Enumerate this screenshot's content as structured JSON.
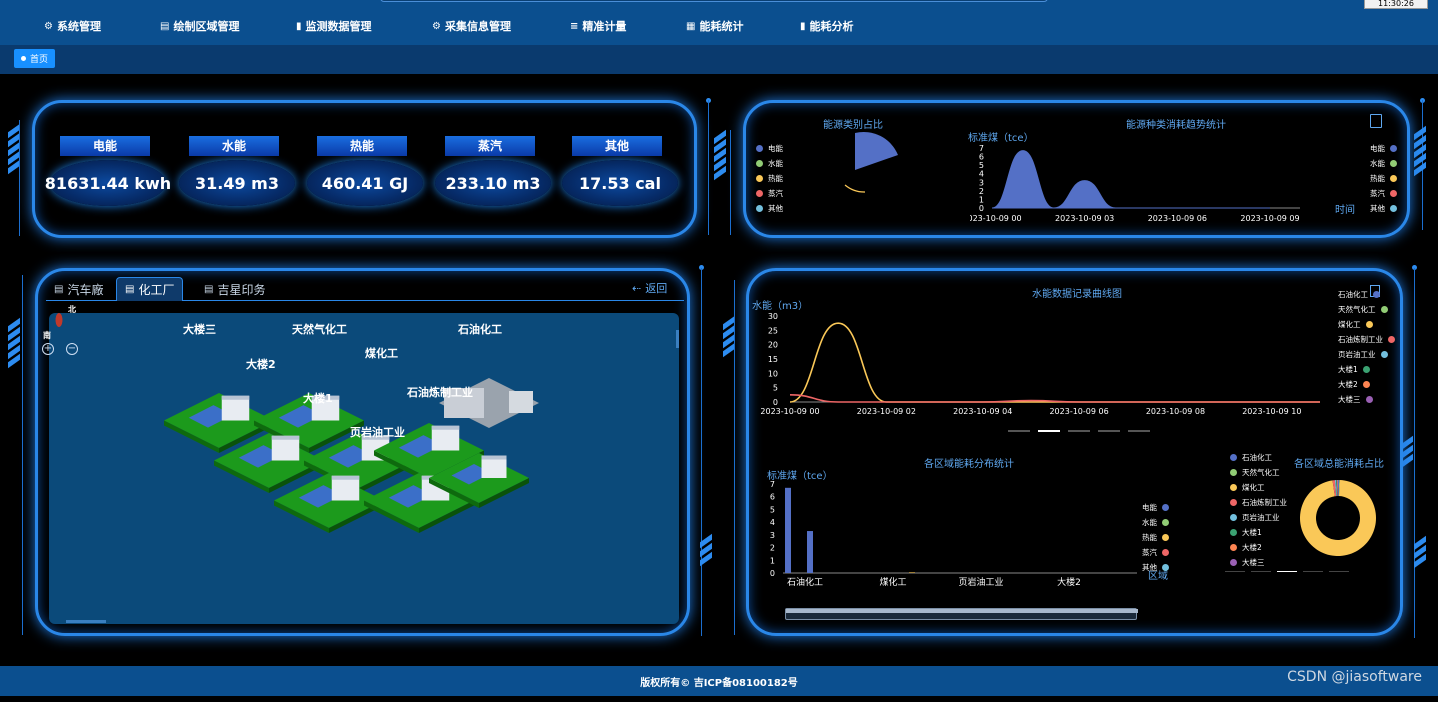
{
  "clock": "11:30:26",
  "nav": [
    {
      "label": "系统管理",
      "icon": "gear-icon",
      "glyph": "⚙"
    },
    {
      "label": "绘制区域管理",
      "icon": "draw-icon",
      "glyph": "▤"
    },
    {
      "label": "监测数据管理",
      "icon": "bar-chart-icon",
      "glyph": "▮"
    },
    {
      "label": "采集信息管理",
      "icon": "gear-icon",
      "glyph": "⚙"
    },
    {
      "label": "精准计量",
      "icon": "sliders-icon",
      "glyph": "≡"
    },
    {
      "label": "能耗统计",
      "icon": "calculator-icon",
      "glyph": "▦"
    },
    {
      "label": "能耗分析",
      "icon": "bar-chart-icon",
      "glyph": "▮"
    }
  ],
  "home_tab": "首页",
  "metrics": [
    {
      "label": "电能",
      "value": "81631.44 kwh"
    },
    {
      "label": "水能",
      "value": "31.49 m3"
    },
    {
      "label": "热能",
      "value": "460.41 GJ"
    },
    {
      "label": "蒸汽",
      "value": "233.10 m3"
    },
    {
      "label": "其他",
      "value": "17.53 cal"
    }
  ],
  "energy_legend": [
    "电能",
    "水能",
    "热能",
    "蒸汽",
    "其他"
  ],
  "energy_colors": [
    "#5470c6",
    "#91cc75",
    "#fac858",
    "#ee6666",
    "#73c0de"
  ],
  "pie_chart": {
    "title": "能源类别占比"
  },
  "trend_chart": {
    "title": "能源种类消耗趋势统计",
    "ylabel": "标准煤（tce）",
    "xlabel": "时间",
    "yticks": [
      "7",
      "6",
      "5",
      "4",
      "3",
      "2",
      "1",
      "0"
    ],
    "xticks": [
      "2023-10-09 00",
      "2023-10-09 03",
      "2023-10-09 06",
      "2023-10-09 09"
    ]
  },
  "tabs": [
    {
      "label": "汽车廠",
      "active": false
    },
    {
      "label": "化工厂",
      "active": true
    },
    {
      "label": "吉星印务",
      "active": false
    }
  ],
  "back_label": "返回",
  "compass": {
    "north": "北",
    "south": "南"
  },
  "map_labels": [
    "大楼三",
    "天然气化工",
    "石油化工",
    "煤化工",
    "大楼2",
    "石油炼制工业",
    "大楼1",
    "页岩油工业"
  ],
  "water_chart": {
    "title": "水能数据记录曲线图",
    "ylabel": "水能（m3）",
    "yticks": [
      "30",
      "25",
      "20",
      "15",
      "10",
      "5",
      "0"
    ],
    "xticks": [
      "2023-10-09 00",
      "2023-10-09 02",
      "2023-10-09 04",
      "2023-10-09 06",
      "2023-10-09 08",
      "2023-10-09 10"
    ],
    "legend": [
      "石油化工",
      "天然气化工",
      "煤化工",
      "石油炼制工业",
      "页岩油工业",
      "大楼1",
      "大楼2",
      "大楼三"
    ]
  },
  "area_chart": {
    "title": "各区域能耗分布统计",
    "ylabel": "标准煤（tce）",
    "xlabel": "区域",
    "yticks": [
      "7",
      "6",
      "5",
      "4",
      "3",
      "2",
      "1",
      "0"
    ],
    "xticks": [
      "石油化工",
      "煤化工",
      "页岩油工业",
      "大楼2"
    ]
  },
  "donut_chart": {
    "title": "各区域总能消耗占比",
    "legend": [
      "石油化工",
      "天然气化工",
      "煤化工",
      "石油炼制工业",
      "页岩油工业",
      "大楼1",
      "大楼2",
      "大楼三"
    ]
  },
  "region_colors": [
    "#5470c6",
    "#91cc75",
    "#fac858",
    "#ee6666",
    "#73c0de",
    "#3ba272",
    "#fc8452",
    "#9a60b4"
  ],
  "footer": "版权所有© 吉ICP备08100182号",
  "watermark": "CSDN @jiasoftware",
  "chart_data": [
    {
      "type": "area",
      "title": "能源种类消耗趋势统计",
      "xlabel": "时间",
      "ylabel": "标准煤（tce）",
      "ylim": [
        0,
        7
      ],
      "x": [
        "2023-10-09 00",
        "2023-10-09 01",
        "2023-10-09 02",
        "2023-10-09 03",
        "2023-10-09 04",
        "2023-10-09 05",
        "2023-10-09 06",
        "2023-10-09 07",
        "2023-10-09 08",
        "2023-10-09 09"
      ],
      "series": [
        {
          "name": "电能",
          "values": [
            0,
            6.7,
            0,
            3.2,
            0,
            0,
            0,
            0,
            0,
            0
          ]
        },
        {
          "name": "水能",
          "values": [
            0,
            0,
            0,
            0,
            0,
            0,
            0,
            0,
            0,
            0
          ]
        },
        {
          "name": "热能",
          "values": [
            0,
            0,
            0,
            0,
            0,
            0,
            0,
            0,
            0,
            0
          ]
        },
        {
          "name": "蒸汽",
          "values": [
            0,
            0,
            0,
            0,
            0,
            0,
            0,
            0,
            0,
            0
          ]
        },
        {
          "name": "其他",
          "values": [
            0,
            0,
            0,
            0,
            0,
            0,
            0,
            0,
            0,
            0
          ]
        }
      ]
    },
    {
      "type": "line",
      "title": "水能数据记录曲线图",
      "ylabel": "水能（m3）",
      "ylim": [
        0,
        30
      ],
      "x": [
        "2023-10-09 00",
        "2023-10-09 01",
        "2023-10-09 02",
        "2023-10-09 03",
        "2023-10-09 04",
        "2023-10-09 05",
        "2023-10-09 06",
        "2023-10-09 07",
        "2023-10-09 08",
        "2023-10-09 09",
        "2023-10-09 10",
        "2023-10-09 11"
      ],
      "series": [
        {
          "name": "煤化工",
          "values": [
            0,
            27.5,
            0,
            0,
            0,
            0,
            0,
            0,
            0,
            0,
            0,
            0
          ]
        },
        {
          "name": "石油炼制工业",
          "values": [
            2.5,
            0,
            0,
            0,
            0,
            0.5,
            0,
            0,
            0,
            0,
            0,
            0
          ]
        }
      ]
    },
    {
      "type": "bar",
      "title": "各区域能耗分布统计",
      "xlabel": "区域",
      "ylabel": "标准煤（tce）",
      "ylim": [
        0,
        7
      ],
      "categories": [
        "石油化工",
        "天然气化工",
        "煤化工",
        "石油炼制工业",
        "页岩油工业",
        "大楼1",
        "大楼2",
        "大楼三"
      ],
      "series": [
        {
          "name": "电能",
          "values": [
            6.7,
            3.3,
            0,
            0,
            0,
            0,
            0,
            0
          ]
        },
        {
          "name": "热能",
          "values": [
            0,
            0,
            0.05,
            0,
            0,
            0,
            0,
            0
          ]
        }
      ]
    },
    {
      "type": "pie",
      "title": "各区域总能消耗占比",
      "categories": [
        "石油化工",
        "天然气化工",
        "煤化工",
        "石油炼制工业",
        "页岩油工业",
        "大楼1",
        "大楼2",
        "大楼三"
      ],
      "values": [
        0.5,
        0.2,
        97,
        1.0,
        0.5,
        0.3,
        0.3,
        0.2
      ]
    },
    {
      "type": "pie",
      "title": "能源类别占比",
      "categories": [
        "电能",
        "水能",
        "热能",
        "蒸汽",
        "其他"
      ],
      "values": [
        99,
        0.2,
        0.3,
        0.3,
        0.2
      ]
    }
  ]
}
